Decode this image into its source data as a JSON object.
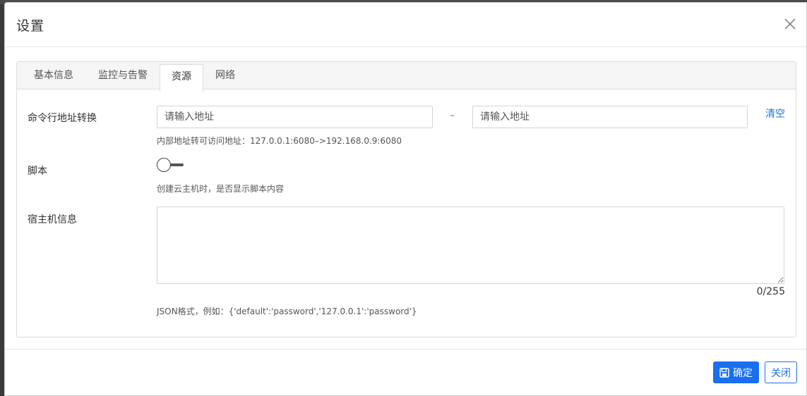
{
  "dialog": {
    "title": "设置"
  },
  "tabs": [
    {
      "label": "基本信息",
      "active": false
    },
    {
      "label": "监控与告警",
      "active": false
    },
    {
      "label": "资源",
      "active": true
    },
    {
      "label": "网络",
      "active": false
    }
  ],
  "address_mapping": {
    "label": "命令行地址转换",
    "from_placeholder": "请输入地址",
    "from_value": "",
    "separator": "–",
    "to_placeholder": "请输入地址",
    "to_value": "",
    "clear_label": "清空",
    "hint": "内部地址转可访问地址：127.0.0.1:6080–>192.168.0.9:6080"
  },
  "script": {
    "label": "脚本",
    "enabled": false,
    "hint": "创建云主机时，是否显示脚本内容"
  },
  "host_info": {
    "label": "宿主机信息",
    "value": "",
    "counter": "0/255",
    "hint": "JSON格式，例如：{'default':'password','127.0.0.1':'password'}"
  },
  "footer": {
    "confirm_label": "确定",
    "close_label": "关闭"
  },
  "colors": {
    "accent": "#1a6ff0",
    "link": "#1a73e8"
  }
}
